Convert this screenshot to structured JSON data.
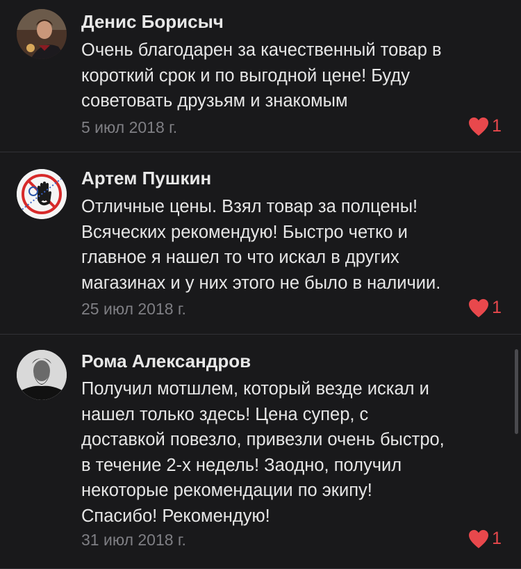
{
  "comments": [
    {
      "author": "Денис Борисыч",
      "lines": [
        "Очень благодарен за качественный товар в",
        "короткий срок и по выгодной цене! Буду",
        "советовать друзьям и знакомым"
      ],
      "date": "5 июл 2018 г.",
      "likes": "1",
      "avatar_icon": "person-photo-avatar"
    },
    {
      "author": "Артем Пушкин",
      "lines": [
        "Отличные цены. Взял товар за полцены!",
        "Всяческих рекомендую! Быстро четко и",
        "главное я нашел то что искал в других",
        "магазинах и у них этого не было в наличии."
      ],
      "date": "25 июл 2018 г.",
      "likes": "1",
      "avatar_icon": "stop-hand-badge-avatar"
    },
    {
      "author": "Рома Александров",
      "lines": [
        "Получил мотшлем, который везде искал и",
        "нашел только здесь! Цена супер, с",
        "доставкой повезло, привезли очень быстро,",
        "в течение 2-х недель! Заодно, получил",
        "некоторые рекомендации по экипу!",
        "Спасибо! Рекомендую!"
      ],
      "date": "31 июл 2018 г.",
      "likes": "1",
      "avatar_icon": "bearded-man-photo-avatar"
    }
  ],
  "colors": {
    "background": "#19191b",
    "text": "#e6e6e6",
    "date": "#7f7f84",
    "like": "#e8484c",
    "divider": "#323236"
  }
}
